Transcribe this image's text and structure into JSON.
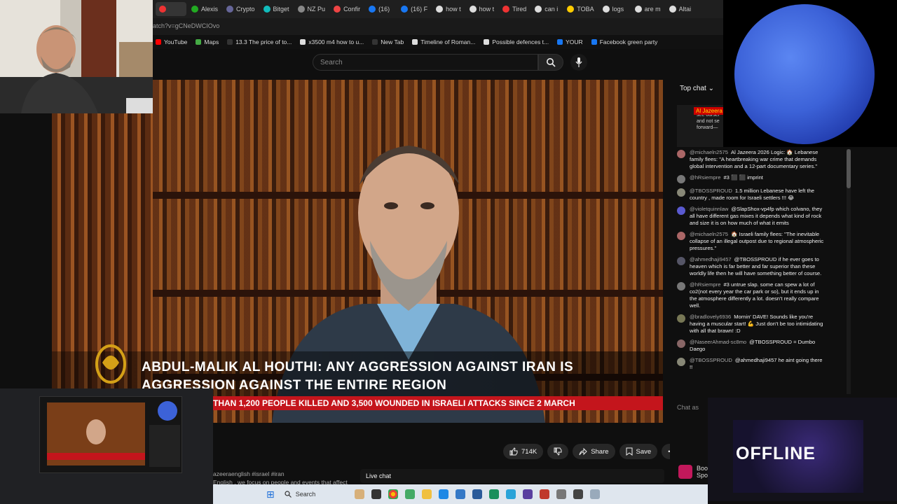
{
  "browser": {
    "tabs": [
      {
        "label": "",
        "color": "#e33"
      },
      {
        "label": "Alexis",
        "color": "#2a2"
      },
      {
        "label": "Crypto",
        "color": "#669"
      },
      {
        "label": "Bitget",
        "color": "#1bb"
      },
      {
        "label": "NZ Pu",
        "color": "#888"
      },
      {
        "label": "Confir",
        "color": "#e44"
      },
      {
        "label": "(16)",
        "color": "#1877f2"
      },
      {
        "label": "(16) F",
        "color": "#1877f2"
      },
      {
        "label": "how t",
        "color": "#ddd"
      },
      {
        "label": "how t",
        "color": "#ddd"
      },
      {
        "label": "Tired",
        "color": "#e33"
      },
      {
        "label": "can i",
        "color": "#ddd"
      },
      {
        "label": "TOBA",
        "color": "#fc0"
      },
      {
        "label": "logs",
        "color": "#ddd"
      },
      {
        "label": "are m",
        "color": "#ddd"
      },
      {
        "label": "Altai",
        "color": "#ddd"
      }
    ],
    "url": "atch?v=gCNeDWCIOvo",
    "bookmarks": [
      {
        "label": "YouTube",
        "color": "#f00"
      },
      {
        "label": "Maps",
        "color": "#4a4"
      },
      {
        "label": "13.3 The price of to...",
        "color": "#333"
      },
      {
        "label": "x3500 m4 how to u...",
        "color": "#ddd"
      },
      {
        "label": "New Tab",
        "color": "#333"
      },
      {
        "label": "Timeline of Roman...",
        "color": "#ddd"
      },
      {
        "label": "Possible defences t...",
        "color": "#ddd"
      },
      {
        "label": "YOUR",
        "color": "#1877f2"
      },
      {
        "label": "Facebook green party",
        "color": "#1877f2"
      }
    ]
  },
  "youtube": {
    "search_placeholder": "Search",
    "video": {
      "headline": "ABDUL-MALIK AL HOUTHI: ANY AGGRESSION AGAINST IRAN IS AGGRESSION AGAINST THE ENTIRE REGION",
      "ticker": "THAN 1,200 PEOPLE KILLED AND 3,500 WOUNDED IN ISRAELI ATTACKS SINCE 2 MARCH",
      "ticker_end": "T"
    },
    "actions": {
      "likes": "714K",
      "share": "Share",
      "save": "Save"
    },
    "description_tags": "azeeraenglish #israel #iran",
    "description_snippet": "English , we focus on people and events that affect",
    "live_chat_label": "Live chat",
    "below_right_text": "Boo",
    "below_right_sub": "Spon"
  },
  "chat": {
    "header": "Top chat",
    "pinned_chip": "Al Jazeera",
    "pinned_text": "see oursel and not se forward—",
    "input_placeholder": "Chat as",
    "messages": [
      {
        "author": "@michaeln2575",
        "text": "Al Jazeera 2026 Logic: 🏠 Lebanese family flees: \"A heartbreaking war crime that demands global intervention and a 12-part documentary series.\"",
        "color": "#a66"
      },
      {
        "author": "@hRsiempre",
        "text": "#3 ⬛ ⬛ imprint",
        "color": "#777"
      },
      {
        "author": "@TBOSSPROUD",
        "text": "1.5 million Lebanese have left the country , made room for Israeli settlers !!! 😂",
        "color": "#887"
      },
      {
        "author": "@violetquinnlaw",
        "text": "@SlapShox-vp4fp which colvano, they all have different gas mixes it depends what kind of rock and size it is on how much of what it emits",
        "color": "#5a5ad0"
      },
      {
        "author": "@michaeln2575",
        "text": "🏠 Israeli family flees: \"The inevitable collapse of an illegal outpost due to regional atmospheric pressures.\"",
        "color": "#a66"
      },
      {
        "author": "@ahmedhaji9457",
        "text": "@TBOSSPROUD if he ever goes to heaven which is far better and far superior than these worldly life then he will have something better of course.",
        "color": "#556"
      },
      {
        "author": "@hRsiempre",
        "text": "#3 untrue slap. some can spew a lot of co2(not every year the car park or so), but it ends up in the atmosphere differently a lot. doesn't really compare well.",
        "color": "#777"
      },
      {
        "author": "@bradlovely6936",
        "text": "Mornin' DAVE! Sounds like you're having a muscular start! 💪 Just don't be too intimidating with all that brawn! :D",
        "color": "#775"
      },
      {
        "author": "@NaseerAhmad-sc8mo",
        "text": "@TBOSSPROUD = Dumbo Daego",
        "color": "#866"
      },
      {
        "author": "@TBOSSPROUD",
        "text": "@ahmedhaji9457 he aint going there !!",
        "color": "#887"
      }
    ]
  },
  "offline_label": "OFFLINE",
  "taskbar": {
    "search": "Search"
  }
}
